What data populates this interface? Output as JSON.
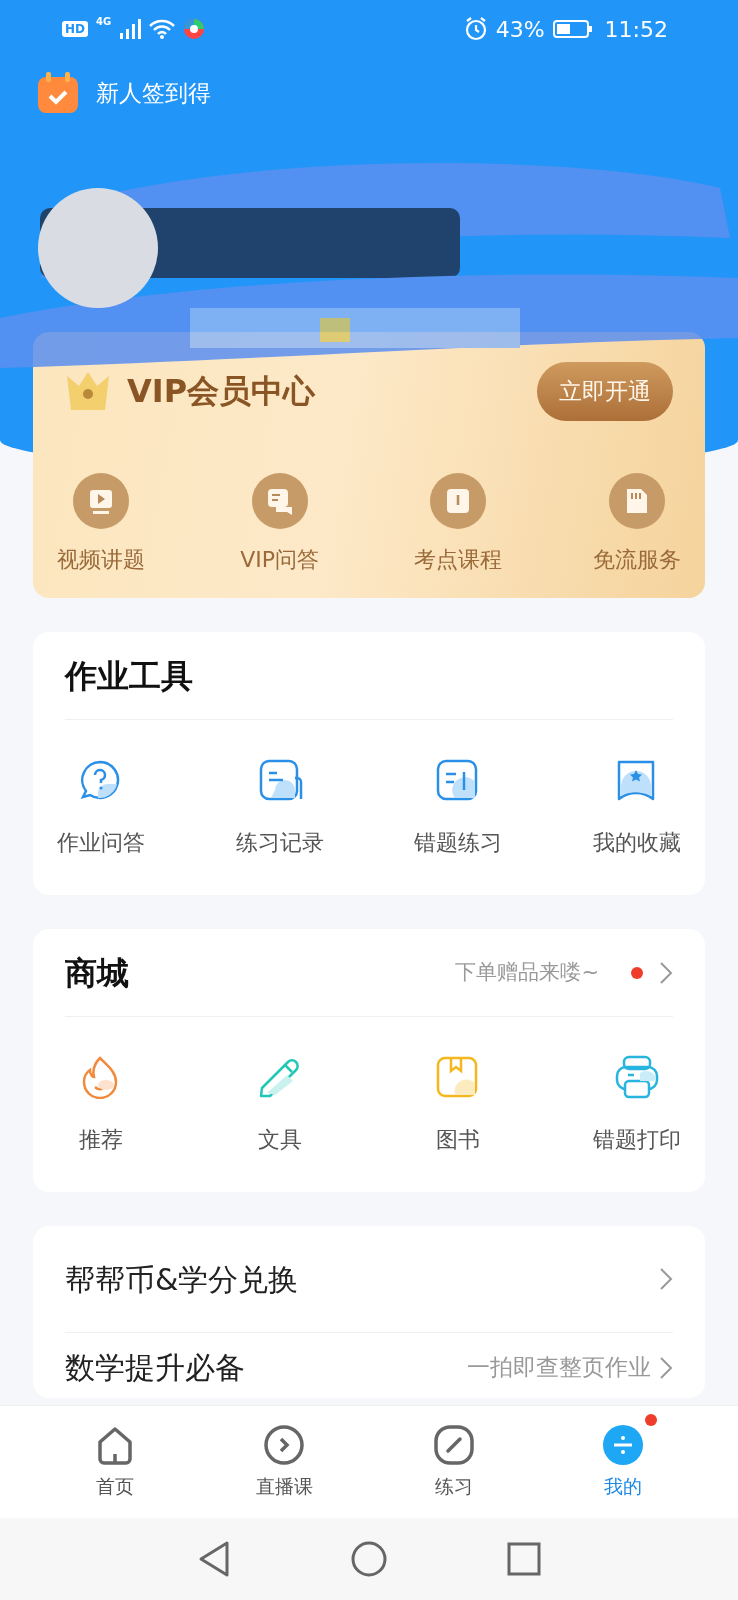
{
  "status_bar": {
    "hd": "HD",
    "network": "4G",
    "battery": "43%",
    "time": "11:52"
  },
  "header": {
    "checkin": "新人签到得"
  },
  "vip": {
    "title": "VIP会员中心",
    "button": "立即开通",
    "items": [
      {
        "label": "视频讲题",
        "kind": "video"
      },
      {
        "label": "VIP问答",
        "kind": "chat"
      },
      {
        "label": "考点课程",
        "kind": "book"
      },
      {
        "label": "免流服务",
        "kind": "sim"
      }
    ]
  },
  "tools": {
    "title": "作业工具",
    "items": [
      {
        "label": "作业问答",
        "kind": "question"
      },
      {
        "label": "练习记录",
        "kind": "record"
      },
      {
        "label": "错题练习",
        "kind": "note"
      },
      {
        "label": "我的收藏",
        "kind": "bookmark"
      }
    ]
  },
  "mall": {
    "title": "商城",
    "promo": "下单赠品来喽~",
    "dot": true,
    "items": [
      {
        "label": "推荐",
        "kind": "flame"
      },
      {
        "label": "文具",
        "kind": "pencil"
      },
      {
        "label": "图书",
        "kind": "book"
      },
      {
        "label": "错题打印",
        "kind": "printer"
      }
    ]
  },
  "list": [
    {
      "label": "帮帮币&学分兑换"
    },
    {
      "label": "数学提升必备",
      "hint": "一拍即查整页作业"
    }
  ],
  "tabs": [
    {
      "label": "首页",
      "kind": "home",
      "selected": false,
      "dot": false
    },
    {
      "label": "直播课",
      "kind": "live",
      "selected": false,
      "dot": false
    },
    {
      "label": "练习",
      "kind": "practice",
      "selected": false,
      "dot": false
    },
    {
      "label": "我的",
      "kind": "mine",
      "selected": true,
      "dot": true
    }
  ]
}
